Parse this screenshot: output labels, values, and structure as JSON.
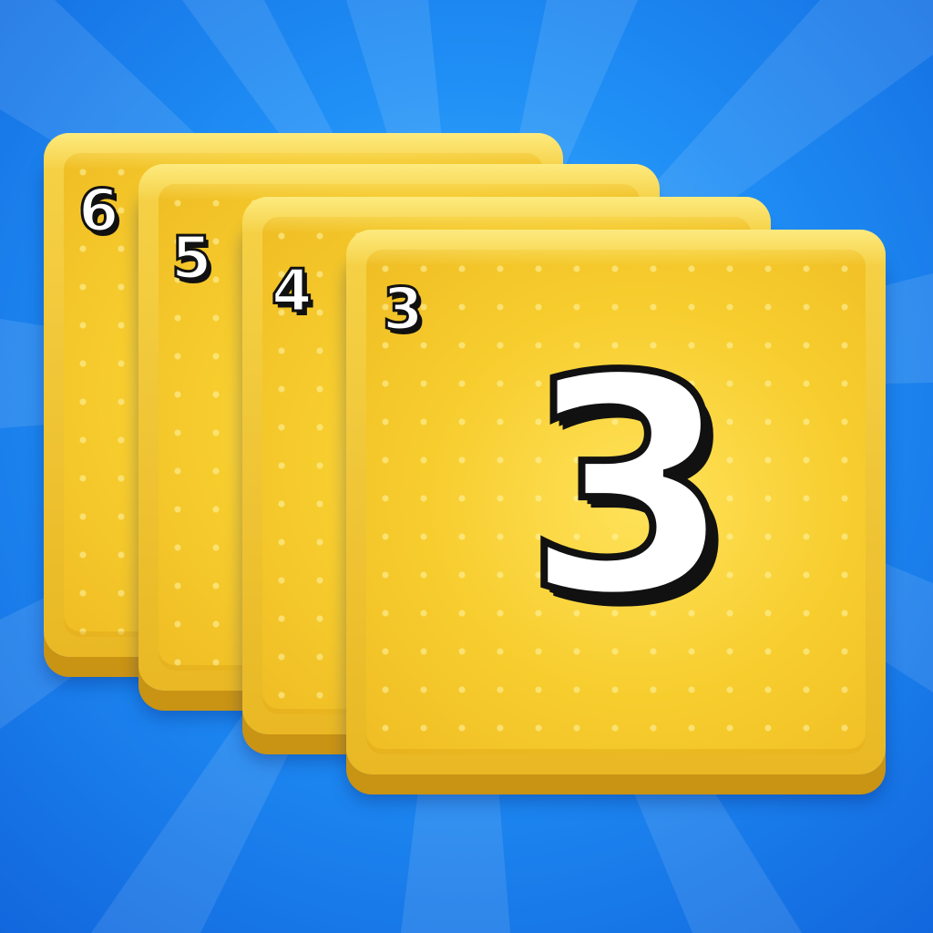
{
  "colors": {
    "background": "#1f8ef5",
    "card": "#f7cd2e",
    "card_edge": "#c99314",
    "number_fill": "#ffffff",
    "number_outline": "#111111"
  },
  "cards": [
    {
      "corner_label": "6"
    },
    {
      "corner_label": "5"
    },
    {
      "corner_label": "4"
    },
    {
      "corner_label": "3",
      "center_label": "3"
    }
  ]
}
